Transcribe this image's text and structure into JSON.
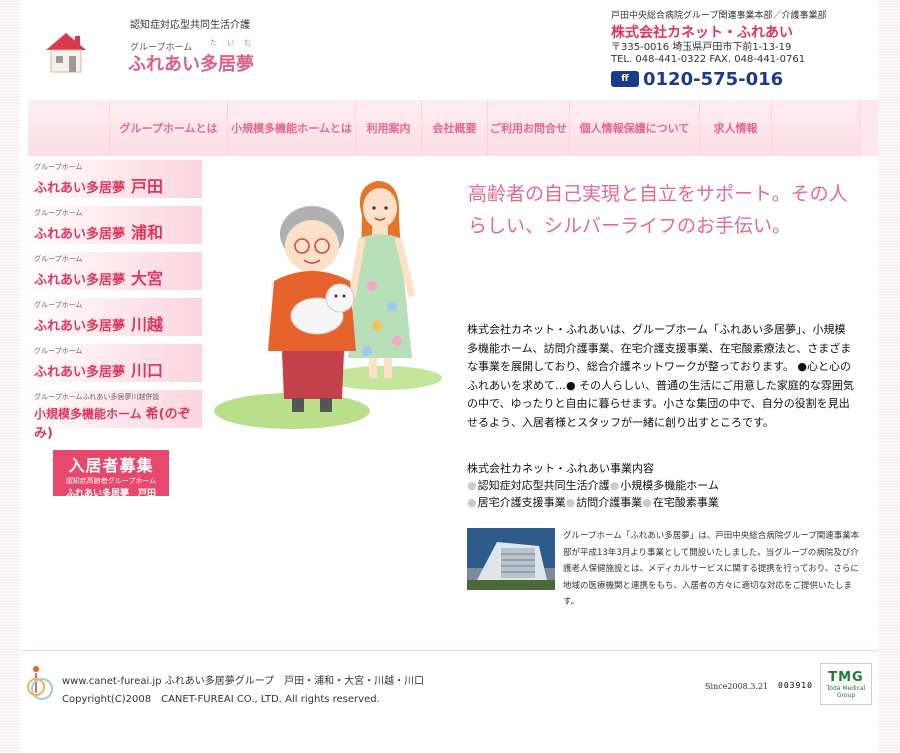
{
  "header": {
    "logo_subtitle": "認知症対応型共同生活介護",
    "logo_kind": "グループホーム",
    "logo_ruby": "たいむ",
    "logo_name": "ふれあい多居夢",
    "company_group": "戸田中央総合病院グループ関連事業本部／介護事業部",
    "company_name": "株式会社カネット・ふれあい",
    "address": "〒335-0016 埼玉県戸田市下前1-13-19",
    "tel": "TEL. 048-441-0322 FAX. 048-441-0761",
    "freedial_icon": "ff",
    "freedial": "0120-575-016"
  },
  "nav": {
    "items": [
      "グループホームとは",
      "小規模多機能ホームとは",
      "利用案内",
      "会社概要",
      "ご利用お問合せ",
      "個人情報保護について",
      "求人情報"
    ]
  },
  "sidebar": {
    "items": [
      {
        "small": "グループホーム",
        "name": "ふれあい多居夢",
        "city": "戸田"
      },
      {
        "small": "グループホーム",
        "name": "ふれあい多居夢",
        "city": "浦和"
      },
      {
        "small": "グループホーム",
        "name": "ふれあい多居夢",
        "city": "大宮"
      },
      {
        "small": "グループホーム",
        "name": "ふれあい多居夢",
        "city": "川越"
      },
      {
        "small": "グループホーム",
        "name": "ふれあい多居夢",
        "city": "川口"
      },
      {
        "small": "グループホームふれあい多居夢川越併設",
        "name": "小規模多機能ホーム",
        "city": "希(のぞみ)"
      }
    ],
    "recruit": {
      "title": "入居者募集",
      "sub": "認知症高齢者グループホーム",
      "name": "ふれあい多居夢　戸田"
    }
  },
  "main": {
    "hero": "高齢者の自己実現と自立をサポート。その人らしい、シルバーライフのお手伝い。",
    "intro": "株式会社カネット・ふれあいは、グループホーム「ふれあい多居夢」、小規模多機能ホーム、訪問介護事業、在宅介護支援事業、在宅酸素療法と、さまざまな事業を展開しており、総合介護ネットワークが整っております。 ●心と心のふれあいを求めて…● その人らしい、普通の生活にご用意した家庭的な雰囲気の中で、ゆったりと自由に暮らせます。小さな集団の中で、自分の役割を見出せるよう、入居者様とスタッフが一緒に創り出すところです。",
    "business_title": "株式会社カネット・ふれあい事業内容",
    "business": [
      "認知症対応型共同生活介護",
      "小規模多機能ホーム",
      "居宅介護支援事業",
      "訪問介護事業",
      "在宅酸素事業"
    ],
    "note": "グループホーム「ふれあい多居夢」は、戸田中央総合病院グループ関連事業本部が平成13年3月より事業として開設いたしました。当グループの病院及び介護老人保健施設とは、メディカルサービスに関する提携を行っており、さらに地域の医療機関と連携をもち、入居者の方々に適切な対応をご提供いたします。"
  },
  "footer": {
    "line1": "www.canet-fureai.jp ふれあい多居夢グループ　戸田・浦和・大宮・川越・川口",
    "line2": "Copyright(C)2008　CANET-FUREAI CO., LTD. All rights reserved.",
    "since": "Since2008.3.21",
    "counter": "003910",
    "tmg": "TMG",
    "tmg_sub": "Toda Medical Group"
  },
  "colors": {
    "accent": "#e46a8a",
    "brand_red": "#e0365e",
    "navy": "#1a3a8c"
  }
}
